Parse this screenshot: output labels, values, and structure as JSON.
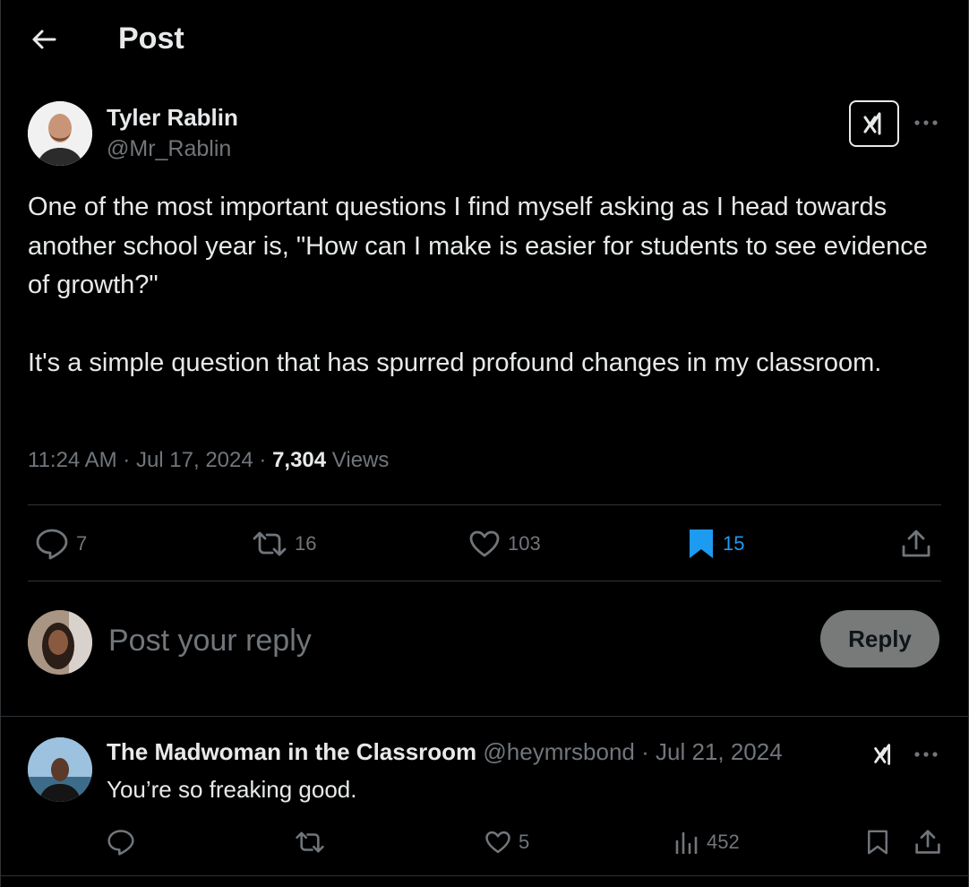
{
  "header": {
    "title": "Post"
  },
  "post": {
    "author_name": "Tyler Rablin",
    "author_handle": "@Mr_Rablin",
    "text": "One of the most important questions I find myself asking as I head towards another school year is, \"How can I make is easier for students to see evidence of growth?\"\n\nIt's a simple question that has spurred profound changes in my classroom.",
    "time": "11:24 AM",
    "date": "Jul 17, 2024",
    "separator": " · ",
    "views_count": "7,304",
    "views_label": "Views",
    "replies": "7",
    "reposts": "16",
    "likes": "103",
    "bookmarks": "15"
  },
  "composer": {
    "placeholder": "Post your reply",
    "button_label": "Reply"
  },
  "replies": [
    {
      "name": "The Madwoman in the Classroom",
      "handle": "@heymrsbond",
      "separator": " · ",
      "date": "Jul 21, 2024",
      "text": "You’re so freaking good.",
      "likes": "5",
      "views": "452"
    }
  ],
  "colors": {
    "background": "#000000",
    "text": "#e7e9ea",
    "muted": "#71767b",
    "accent": "#1d9bf0",
    "divider": "#2f3336",
    "reply_button": "#787a7a"
  },
  "icons": {
    "back": "arrow-left-icon",
    "grok": "grok-icon",
    "more": "more-horizontal-icon",
    "reply": "speech-bubble-icon",
    "repost": "repost-icon",
    "like": "heart-icon",
    "bookmark": "bookmark-icon",
    "share": "share-icon",
    "views": "bar-chart-icon"
  }
}
